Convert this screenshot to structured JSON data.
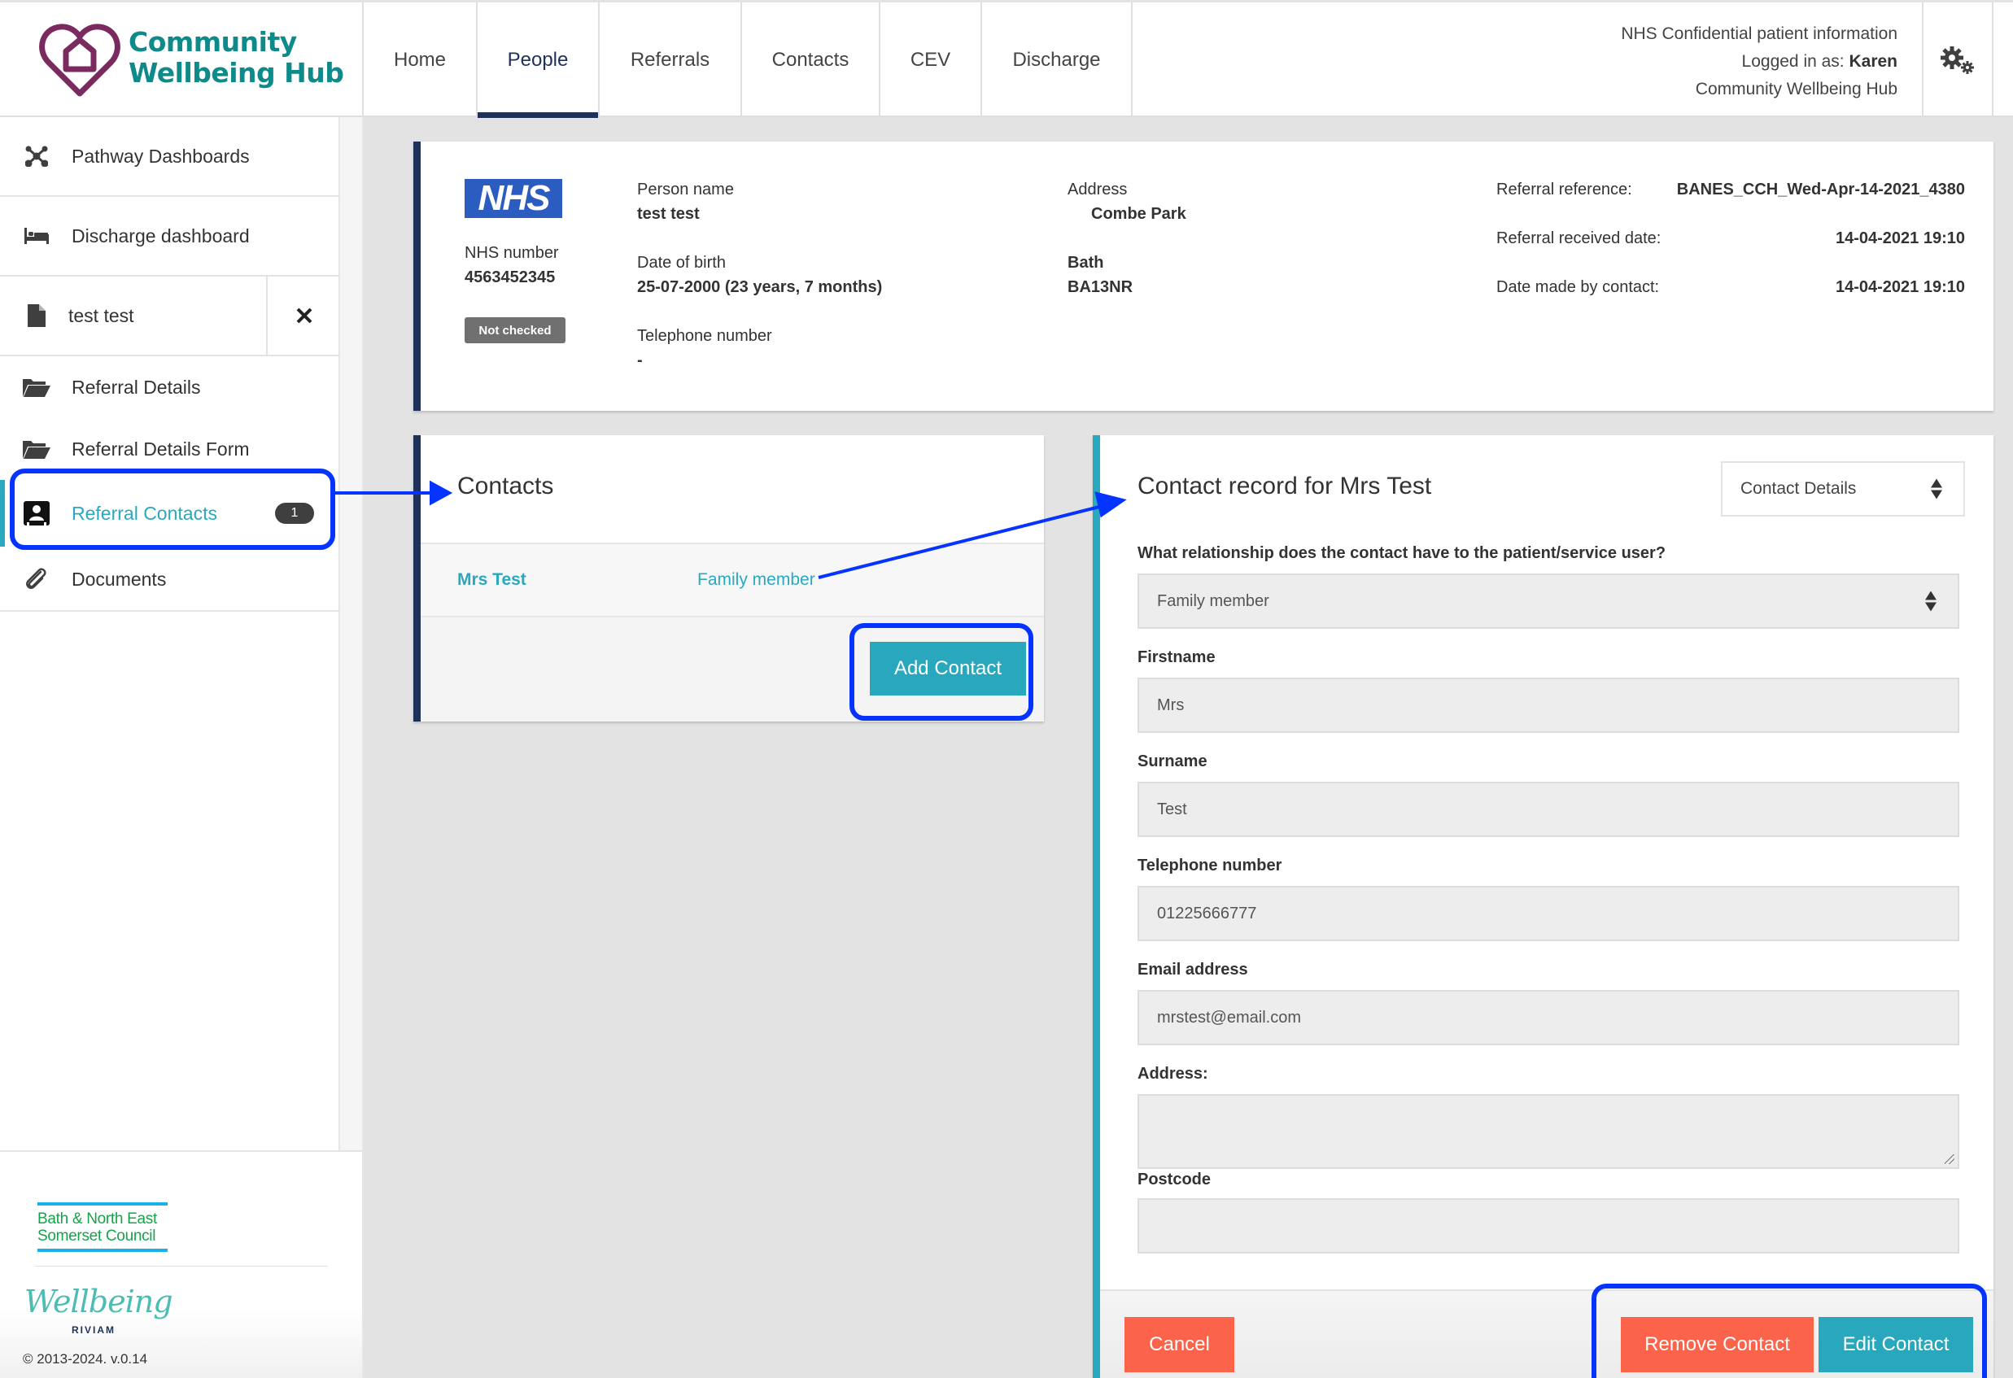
{
  "header": {
    "logo_line1": "Community",
    "logo_line2": "Wellbeing Hub",
    "nav": [
      {
        "label": "Home",
        "active": false
      },
      {
        "label": "People",
        "active": true
      },
      {
        "label": "Referrals",
        "active": false
      },
      {
        "label": "Contacts",
        "active": false
      },
      {
        "label": "CEV",
        "active": false
      },
      {
        "label": "Discharge",
        "active": false
      }
    ],
    "info_line1": "NHS Confidential patient information",
    "logged_in_prefix": "Logged in as: ",
    "logged_in_user": "Karen",
    "organisation": "Community Wellbeing Hub",
    "settings_icon": "gears-icon"
  },
  "sidebar": {
    "items": [
      {
        "label": "Pathway Dashboards",
        "icon": "network-icon"
      },
      {
        "label": "Discharge dashboard",
        "icon": "bed-icon"
      },
      {
        "label": "test test",
        "icon": "file-icon"
      },
      {
        "label": "Referral Details",
        "icon": "folder-open-icon"
      },
      {
        "label": "Referral Details Form",
        "icon": "folder-open-icon"
      },
      {
        "label": "Referral Contacts",
        "icon": "contact-card-icon",
        "badge": "1",
        "active": true
      },
      {
        "label": "Documents",
        "icon": "paperclip-icon"
      }
    ],
    "close_icon": "close-icon",
    "footer": {
      "council_line1": "Bath & North East",
      "council_line2": "Somerset Council",
      "wellbeing": "Wellbeing",
      "riviam": "RIVIAM",
      "copyright": "© 2013-2024. v.0.14"
    }
  },
  "patient": {
    "nhs_logo": "NHS",
    "nhs_number_label": "NHS number",
    "nhs_number": "4563452345",
    "verification_status": "Not checked",
    "person_name_label": "Person name",
    "person_name": "test test",
    "dob_label": "Date of birth",
    "dob": "25-07-2000 (23 years, 7 months)",
    "telephone_label": "Telephone number",
    "telephone": "-",
    "address_label": "Address",
    "address_line1": "Combe Park",
    "address_town": "Bath",
    "address_postcode": "BA13NR",
    "referral_reference_label": "Referral reference:",
    "referral_reference": "BANES_CCH_Wed-Apr-14-2021_4380",
    "referral_received_label": "Referral received date:",
    "referral_received": "14-04-2021 19:10",
    "date_made_label": "Date made by contact:",
    "date_made": "14-04-2021 19:10"
  },
  "contacts": {
    "title": "Contacts",
    "rows": [
      {
        "name": "Mrs Test",
        "relationship": "Family member"
      }
    ],
    "add_button": "Add Contact"
  },
  "contact_record": {
    "title": "Contact record for Mrs Test",
    "view_select": "Contact Details",
    "fields": {
      "relationship_label": "What relationship does the contact have to the patient/service user?",
      "relationship_value": "Family member",
      "firstname_label": "Firstname",
      "firstname_value": "Mrs",
      "surname_label": "Surname",
      "surname_value": "Test",
      "telephone_label": "Telephone number",
      "telephone_value": "01225666777",
      "email_label": "Email address",
      "email_value": "mrstest@email.com",
      "address_label": "Address:",
      "address_value": "",
      "postcode_label": "Postcode",
      "postcode_value": ""
    },
    "cancel_button": "Cancel",
    "remove_button": "Remove Contact",
    "edit_button": "Edit Contact"
  },
  "colors": {
    "navy": "#1f3158",
    "teal": "#2aa8be",
    "button_teal": "#28a7bd",
    "button_red": "#fb634a",
    "annotation_blue": "#0533ff"
  }
}
